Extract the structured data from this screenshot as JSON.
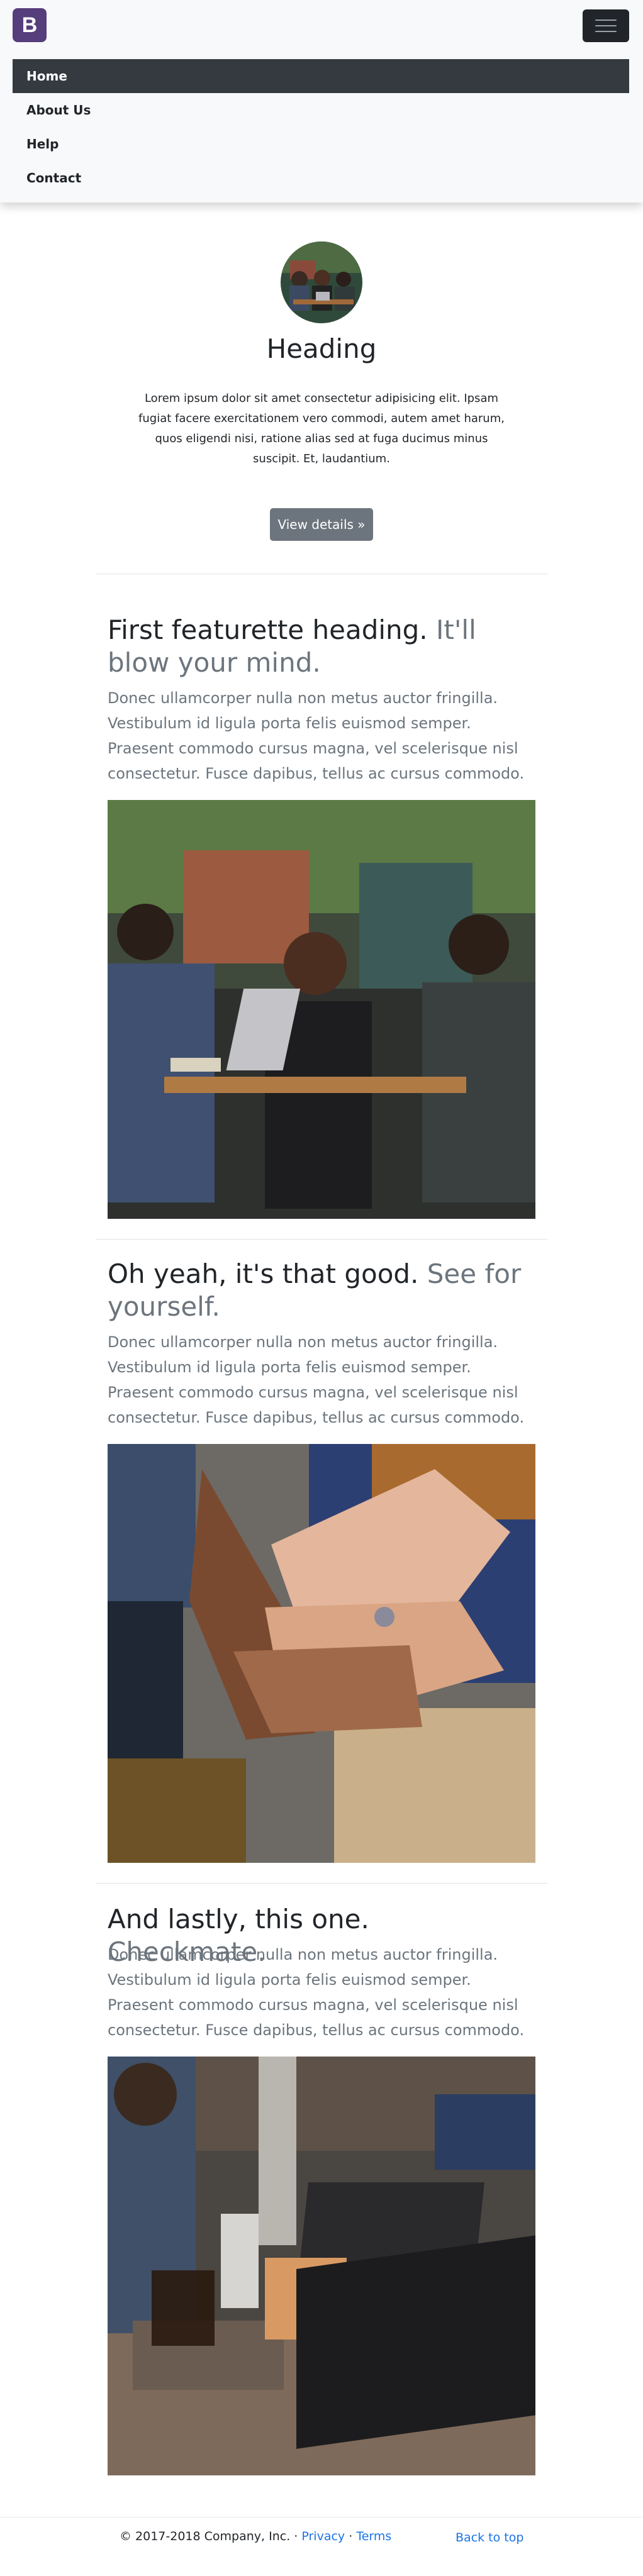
{
  "navbar": {
    "brand_letter": "B",
    "items": [
      {
        "label": "Home"
      },
      {
        "label": "About Us"
      },
      {
        "label": "Help"
      },
      {
        "label": "Contact"
      }
    ]
  },
  "hero": {
    "title": "Heading",
    "text": "Lorem ipsum dolor sit amet consectetur adipisicing elit. Ipsam fugiat facere exercitationem vero commodi, autem amet harum, quos eligendi nisi, ratione alias sed at fuga ducimus minus suscipit. Et, laudantium.",
    "button_label": "View details »"
  },
  "featurettes": [
    {
      "heading": "First featurette heading.",
      "muted": "It'll blow your mind.",
      "text": "Donec ullamcorper nulla non metus auctor fringilla. Vestibulum id ligula porta felis euismod semper. Praesent commodo cursus magna, vel scelerisque nisl consectetur. Fusce dapibus, tellus ac cursus commodo."
    },
    {
      "heading": "Oh yeah, it's that good.",
      "muted": "See for yourself.",
      "text": "Donec ullamcorper nulla non metus auctor fringilla. Vestibulum id ligula porta felis euismod semper. Praesent commodo cursus magna, vel scelerisque nisl consectetur. Fusce dapibus, tellus ac cursus commodo."
    },
    {
      "heading": "And lastly, this one.",
      "muted": "Checkmate.",
      "text": "Donec ullamcorper nulla non metus auctor fringilla. Vestibulum id ligula porta felis euismod semper. Praesent commodo cursus magna, vel scelerisque nisl consectetur. Fusce dapibus, tellus ac cursus commodo."
    }
  ],
  "footer": {
    "copyright": "© 2017-2018 Company, Inc. ·",
    "privacy": "Privacy",
    "separator": "·",
    "terms": "Terms",
    "back_to_top": "Back to top"
  },
  "colors": {
    "brand": "#563d7c",
    "nav_active": "#343a40",
    "muted": "#6c757d",
    "link": "#1a73e8"
  }
}
